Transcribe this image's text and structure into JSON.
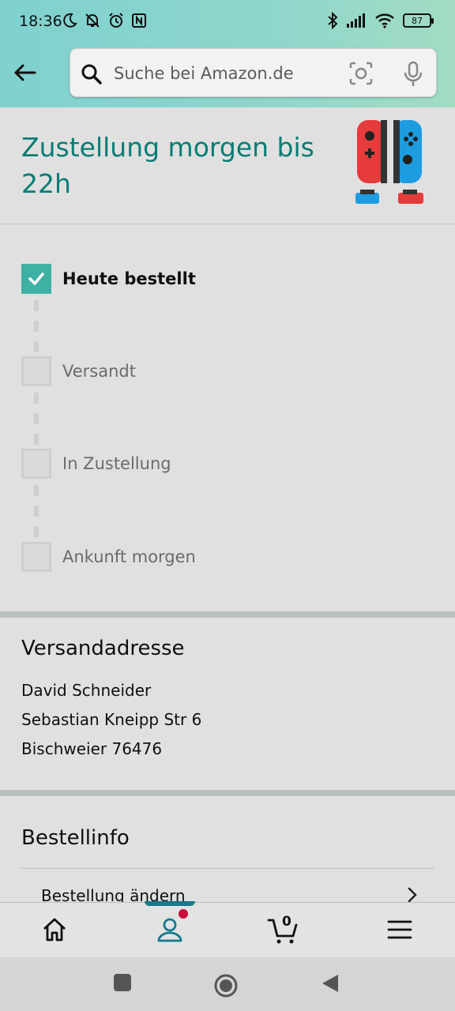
{
  "status_bar": {
    "time": "18:36",
    "battery": "87"
  },
  "search": {
    "placeholder": "Suche bei Amazon.de"
  },
  "delivery": {
    "title": "Zustellung morgen bis 22h"
  },
  "tracker": {
    "steps": [
      {
        "label": "Heute bestellt",
        "done": true
      },
      {
        "label": "Versandt",
        "done": false
      },
      {
        "label": "In Zustellung",
        "done": false
      },
      {
        "label": "Ankunft morgen",
        "done": false
      }
    ]
  },
  "address": {
    "heading": "Versandadresse",
    "lines": [
      "David Schneider",
      "Sebastian Kneipp Str 6",
      "Bischweier 76476"
    ]
  },
  "order_info": {
    "heading": "Bestellinfo",
    "change_order": "Bestellung ändern"
  },
  "bottom_nav": {
    "cart_count": "0",
    "items": [
      "home-icon",
      "account-icon",
      "cart-icon",
      "menu-icon"
    ]
  },
  "colors": {
    "accent": "#067d74",
    "check_green": "#3fb1a4",
    "notification": "#cc0c39",
    "nav_indicator": "#157a8c"
  }
}
